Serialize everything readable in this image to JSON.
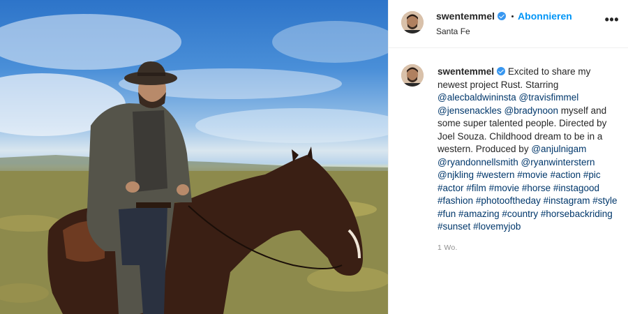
{
  "post": {
    "username": "swentemmel",
    "follow_label": "Abonnieren",
    "location": "Santa Fe",
    "more_label": "•••",
    "caption_intro": "Excited to share my newest project Rust. Starring",
    "mention_1": "@alecbaldwininsta",
    "mention_2": "@travisfimmel",
    "mention_3": "@jensenackles",
    "mention_4": "@bradynoon",
    "caption_mid": "myself and some super talented people. Directed by Joel Souza. Childhood dream to be in a western. Produced by",
    "mention_5": "@anjulnigam",
    "mention_6": "@ryandonnellsmith",
    "mention_7": "@ryanwinterstern",
    "mention_8": "@njkling",
    "hashtags": [
      "#western",
      "#movie",
      "#action",
      "#pic",
      "#actor",
      "#film",
      "#movie",
      "#horse",
      "#instagood",
      "#fashion",
      "#photooftheday",
      "#instagram",
      "#style",
      "#fun",
      "#amazing",
      "#country",
      "#horsebackriding",
      "#sunset",
      "#lovemyjob"
    ],
    "timestamp": "1 Wo."
  },
  "colors": {
    "link": "#00376b",
    "follow": "#0095f6",
    "verified": "#3897f0"
  },
  "icons": {
    "verified": "verified-badge-icon",
    "more": "more-options-icon"
  }
}
